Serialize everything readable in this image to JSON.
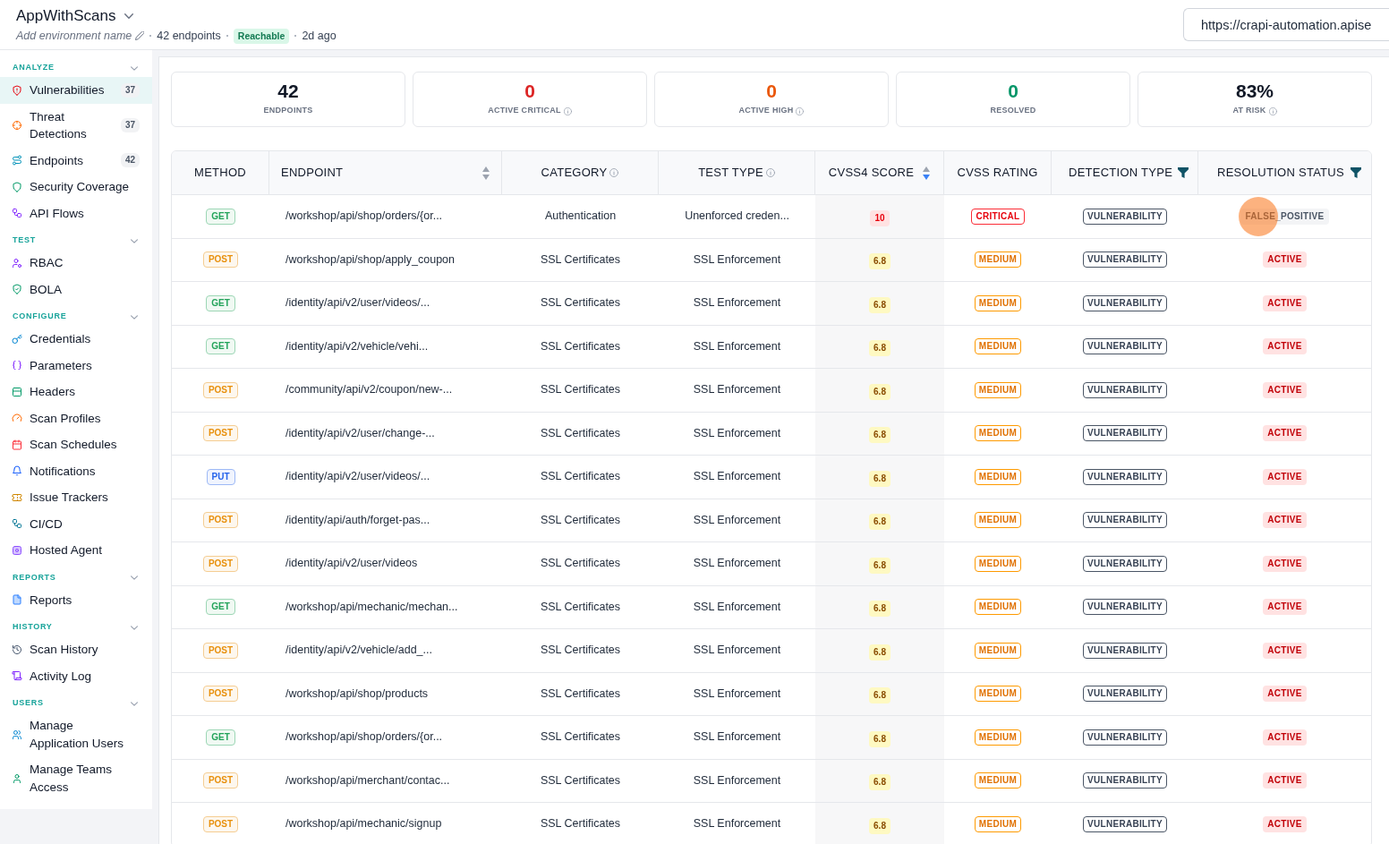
{
  "app_header": {
    "title": "AppWithScans",
    "environment_name_prompt": "Add environment name",
    "endpoint_count": "42 endpoints",
    "reachability": "Reachable",
    "last_scanned": "2d ago",
    "url_field": {
      "value": "https://crapi-automation.apise"
    }
  },
  "sidebar": {
    "sections": [
      {
        "title": "ANALYZE",
        "expanded": true,
        "items": [
          {
            "label": "Vulnerabilities",
            "count": "37",
            "selected": true
          },
          {
            "label": "Threat Detections",
            "count": "37",
            "selected": false
          },
          {
            "label": "Endpoints",
            "count": "42",
            "selected": false
          },
          {
            "label": "Security Coverage",
            "selected": false
          },
          {
            "label": "API Flows",
            "selected": false
          }
        ]
      },
      {
        "title": "TEST",
        "expanded": true,
        "items": [
          {
            "label": "RBAC",
            "selected": false
          },
          {
            "label": "BOLA",
            "selected": false
          }
        ]
      },
      {
        "title": "CONFIGURE",
        "expanded": true,
        "items": [
          {
            "label": "Credentials",
            "selected": false
          },
          {
            "label": "Parameters",
            "selected": false
          },
          {
            "label": "Headers",
            "selected": false
          },
          {
            "label": "Scan Profiles",
            "selected": false
          },
          {
            "label": "Scan Schedules",
            "selected": false
          },
          {
            "label": "Notifications",
            "selected": false
          },
          {
            "label": "Issue Trackers",
            "selected": false
          },
          {
            "label": "CI/CD",
            "selected": false
          },
          {
            "label": "Hosted Agent",
            "selected": false
          }
        ]
      },
      {
        "title": "REPORTS",
        "expanded": true,
        "items": [
          {
            "label": "Reports",
            "selected": false
          }
        ]
      },
      {
        "title": "HISTORY",
        "expanded": true,
        "items": [
          {
            "label": "Scan History",
            "selected": false
          },
          {
            "label": "Activity Log",
            "selected": false
          }
        ]
      },
      {
        "title": "USERS",
        "expanded": true,
        "items": [
          {
            "label": "Manage Application Users",
            "selected": false
          },
          {
            "label": "Manage Teams Access",
            "selected": false
          }
        ]
      }
    ]
  },
  "stats": [
    {
      "value": "42",
      "label": "ENDPOINTS",
      "color": "#111827",
      "info": false
    },
    {
      "value": "0",
      "label": "ACTIVE CRITICAL",
      "color": "#dc2626",
      "info": true
    },
    {
      "value": "0",
      "label": "ACTIVE HIGH",
      "color": "#ea580c",
      "info": true
    },
    {
      "value": "0",
      "label": "RESOLVED",
      "color": "#059669",
      "info": false
    },
    {
      "value": "83%",
      "label": "AT RISK",
      "color": "#111827",
      "info": true
    }
  ],
  "table": {
    "columns": [
      {
        "label": "METHOD",
        "sortable": false,
        "info": false,
        "filter": false
      },
      {
        "label": "ENDPOINT",
        "sortable": true,
        "sorted_descending": false,
        "info": false,
        "filter": false
      },
      {
        "label": "CATEGORY",
        "sortable": false,
        "info": true,
        "filter": false
      },
      {
        "label": "TEST TYPE",
        "sortable": false,
        "info": true,
        "filter": false
      },
      {
        "label": "CVSS4 SCORE",
        "sortable": true,
        "sorted_descending": true,
        "info": false,
        "filter": false
      },
      {
        "label": "CVSS RATING",
        "sortable": false,
        "info": false,
        "filter": false
      },
      {
        "label": "DETECTION TYPE",
        "sortable": false,
        "info": false,
        "filter": true
      },
      {
        "label": "RESOLUTION STATUS",
        "sortable": false,
        "info": false,
        "filter": true
      }
    ],
    "rows": [
      {
        "method": {
          "text": "GET",
          "color": "#23a35a"
        },
        "endpoint": "/workshop/api/shop/orders/{or...",
        "category": "Authentication",
        "test_type": "Unenforced creden...",
        "cvss4_score": {
          "text": "10",
          "kind": "critical"
        },
        "cvss_rating": {
          "text": "CRITICAL",
          "kind": "critical"
        },
        "detection_type": "VULNERABILITY",
        "resolution_status": {
          "text": "FALSE_POSITIVE",
          "kind": "false_positive",
          "clicked": true
        }
      },
      {
        "method": {
          "text": "POST",
          "color": "#e8900c"
        },
        "endpoint": "/workshop/api/shop/apply_coupon",
        "category": "SSL Certificates",
        "test_type": "SSL Enforcement",
        "cvss4_score": {
          "text": "6.8",
          "kind": "medium"
        },
        "cvss_rating": {
          "text": "MEDIUM",
          "kind": "medium"
        },
        "detection_type": "VULNERABILITY",
        "resolution_status": {
          "text": "ACTIVE",
          "kind": "active",
          "clicked": false
        }
      },
      {
        "method": {
          "text": "GET",
          "color": "#23a35a"
        },
        "endpoint": "/identity/api/v2/user/videos/...",
        "category": "SSL Certificates",
        "test_type": "SSL Enforcement",
        "cvss4_score": {
          "text": "6.8",
          "kind": "medium"
        },
        "cvss_rating": {
          "text": "MEDIUM",
          "kind": "medium"
        },
        "detection_type": "VULNERABILITY",
        "resolution_status": {
          "text": "ACTIVE",
          "kind": "active",
          "clicked": false
        }
      },
      {
        "method": {
          "text": "GET",
          "color": "#23a35a"
        },
        "endpoint": "/identity/api/v2/vehicle/vehi...",
        "category": "SSL Certificates",
        "test_type": "SSL Enforcement",
        "cvss4_score": {
          "text": "6.8",
          "kind": "medium"
        },
        "cvss_rating": {
          "text": "MEDIUM",
          "kind": "medium"
        },
        "detection_type": "VULNERABILITY",
        "resolution_status": {
          "text": "ACTIVE",
          "kind": "active",
          "clicked": false
        }
      },
      {
        "method": {
          "text": "POST",
          "color": "#e8900c"
        },
        "endpoint": "/community/api/v2/coupon/new-...",
        "category": "SSL Certificates",
        "test_type": "SSL Enforcement",
        "cvss4_score": {
          "text": "6.8",
          "kind": "medium"
        },
        "cvss_rating": {
          "text": "MEDIUM",
          "kind": "medium"
        },
        "detection_type": "VULNERABILITY",
        "resolution_status": {
          "text": "ACTIVE",
          "kind": "active",
          "clicked": false
        }
      },
      {
        "method": {
          "text": "POST",
          "color": "#e8900c"
        },
        "endpoint": "/identity/api/v2/user/change-...",
        "category": "SSL Certificates",
        "test_type": "SSL Enforcement",
        "cvss4_score": {
          "text": "6.8",
          "kind": "medium"
        },
        "cvss_rating": {
          "text": "MEDIUM",
          "kind": "medium"
        },
        "detection_type": "VULNERABILITY",
        "resolution_status": {
          "text": "ACTIVE",
          "kind": "active",
          "clicked": false
        }
      },
      {
        "method": {
          "text": "PUT",
          "color": "#2563eb"
        },
        "endpoint": "/identity/api/v2/user/videos/...",
        "category": "SSL Certificates",
        "test_type": "SSL Enforcement",
        "cvss4_score": {
          "text": "6.8",
          "kind": "medium"
        },
        "cvss_rating": {
          "text": "MEDIUM",
          "kind": "medium"
        },
        "detection_type": "VULNERABILITY",
        "resolution_status": {
          "text": "ACTIVE",
          "kind": "active",
          "clicked": false
        }
      },
      {
        "method": {
          "text": "POST",
          "color": "#e8900c"
        },
        "endpoint": "/identity/api/auth/forget-pas...",
        "category": "SSL Certificates",
        "test_type": "SSL Enforcement",
        "cvss4_score": {
          "text": "6.8",
          "kind": "medium"
        },
        "cvss_rating": {
          "text": "MEDIUM",
          "kind": "medium"
        },
        "detection_type": "VULNERABILITY",
        "resolution_status": {
          "text": "ACTIVE",
          "kind": "active",
          "clicked": false
        }
      },
      {
        "method": {
          "text": "POST",
          "color": "#e8900c"
        },
        "endpoint": "/identity/api/v2/user/videos",
        "category": "SSL Certificates",
        "test_type": "SSL Enforcement",
        "cvss4_score": {
          "text": "6.8",
          "kind": "medium"
        },
        "cvss_rating": {
          "text": "MEDIUM",
          "kind": "medium"
        },
        "detection_type": "VULNERABILITY",
        "resolution_status": {
          "text": "ACTIVE",
          "kind": "active",
          "clicked": false
        }
      },
      {
        "method": {
          "text": "GET",
          "color": "#23a35a"
        },
        "endpoint": "/workshop/api/mechanic/mechan...",
        "category": "SSL Certificates",
        "test_type": "SSL Enforcement",
        "cvss4_score": {
          "text": "6.8",
          "kind": "medium"
        },
        "cvss_rating": {
          "text": "MEDIUM",
          "kind": "medium"
        },
        "detection_type": "VULNERABILITY",
        "resolution_status": {
          "text": "ACTIVE",
          "kind": "active",
          "clicked": false
        }
      },
      {
        "method": {
          "text": "POST",
          "color": "#e8900c"
        },
        "endpoint": "/identity/api/v2/vehicle/add_...",
        "category": "SSL Certificates",
        "test_type": "SSL Enforcement",
        "cvss4_score": {
          "text": "6.8",
          "kind": "medium"
        },
        "cvss_rating": {
          "text": "MEDIUM",
          "kind": "medium"
        },
        "detection_type": "VULNERABILITY",
        "resolution_status": {
          "text": "ACTIVE",
          "kind": "active",
          "clicked": false
        }
      },
      {
        "method": {
          "text": "POST",
          "color": "#e8900c"
        },
        "endpoint": "/workshop/api/shop/products",
        "category": "SSL Certificates",
        "test_type": "SSL Enforcement",
        "cvss4_score": {
          "text": "6.8",
          "kind": "medium"
        },
        "cvss_rating": {
          "text": "MEDIUM",
          "kind": "medium"
        },
        "detection_type": "VULNERABILITY",
        "resolution_status": {
          "text": "ACTIVE",
          "kind": "active",
          "clicked": false
        }
      },
      {
        "method": {
          "text": "GET",
          "color": "#23a35a"
        },
        "endpoint": "/workshop/api/shop/orders/{or...",
        "category": "SSL Certificates",
        "test_type": "SSL Enforcement",
        "cvss4_score": {
          "text": "6.8",
          "kind": "medium"
        },
        "cvss_rating": {
          "text": "MEDIUM",
          "kind": "medium"
        },
        "detection_type": "VULNERABILITY",
        "resolution_status": {
          "text": "ACTIVE",
          "kind": "active",
          "clicked": false
        }
      },
      {
        "method": {
          "text": "POST",
          "color": "#e8900c"
        },
        "endpoint": "/workshop/api/merchant/contac...",
        "category": "SSL Certificates",
        "test_type": "SSL Enforcement",
        "cvss4_score": {
          "text": "6.8",
          "kind": "medium"
        },
        "cvss_rating": {
          "text": "MEDIUM",
          "kind": "medium"
        },
        "detection_type": "VULNERABILITY",
        "resolution_status": {
          "text": "ACTIVE",
          "kind": "active",
          "clicked": false
        }
      },
      {
        "method": {
          "text": "POST",
          "color": "#e8900c"
        },
        "endpoint": "/workshop/api/mechanic/signup",
        "category": "SSL Certificates",
        "test_type": "SSL Enforcement",
        "cvss4_score": {
          "text": "6.8",
          "kind": "medium"
        },
        "cvss_rating": {
          "text": "MEDIUM",
          "kind": "medium"
        },
        "detection_type": "VULNERABILITY",
        "resolution_status": {
          "text": "ACTIVE",
          "kind": "active",
          "clicked": false
        }
      }
    ]
  }
}
